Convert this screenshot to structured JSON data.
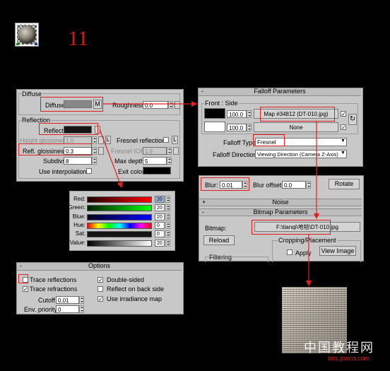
{
  "step_number": "11",
  "material_panel": {
    "diffuse_title": "Diffuse",
    "diffuse_label": "Diffuse",
    "diffuse_map_button": "M",
    "roughness_label": "Roughness",
    "roughness_value": "0.0",
    "reflection_title": "Reflection",
    "reflect_label": "Reflect",
    "hilight_glossiness_label": "Hilight glossiness",
    "hilight_glossiness_value": "1.0",
    "l_button": "L",
    "refl_glossiness_label": "Refl. glossiness",
    "refl_glossiness_value": "0.3",
    "subdivs_label": "Subdivs",
    "subdivs_value": "8",
    "use_interpolation_label": "Use interpolation",
    "fresnel_reflections_label": "Fresnel reflections",
    "fresnel_ior_label": "Fresnel IOR",
    "fresnel_ior_value": "1.6",
    "max_depth_label": "Max depth",
    "max_depth_value": "5",
    "exit_color_label": "Exit color"
  },
  "color_picker": {
    "rows": [
      {
        "label": "Red:",
        "value": "20"
      },
      {
        "label": "Green:",
        "value": "20"
      },
      {
        "label": "Blue:",
        "value": "20"
      },
      {
        "label": "Hue:",
        "value": "0"
      },
      {
        "label": "Sat:",
        "value": "0"
      },
      {
        "label": "Value:",
        "value": "20"
      }
    ]
  },
  "options_panel": {
    "title": "Options",
    "trace_reflections": "Trace reflections",
    "trace_refractions": "Trace refractions",
    "cutoff_label": "Cutoff",
    "cutoff_value": "0.01",
    "env_priority_label": "Env. priority",
    "env_priority_value": "0",
    "double_sided": "Double-sided",
    "reflect_on_back_side": "Reflect on back side",
    "use_irradiance_map": "Use irradiance map"
  },
  "falloff_panel": {
    "title": "Falloff Parameters",
    "front_side_label": "Front : Side",
    "front_amount": "100.0",
    "front_map": "Map #34812 (DT-010.jpg)",
    "side_amount": "100.0",
    "side_map": "None",
    "falloff_type_label": "Falloff Type:",
    "falloff_type_value": "Fresnel",
    "falloff_direction_label": "Falloff Direction:",
    "falloff_direction_value": "Viewing Direction (Camera Z-Axis)"
  },
  "bitmap_panel": {
    "blur_label": "Blur:",
    "blur_value": "0.01",
    "blur_offset_label": "Blur offset:",
    "blur_offset_value": "0.0",
    "rotate_button": "Rotate",
    "noise_title": "Noise",
    "bitmap_params_title": "Bitmap Parameters",
    "bitmap_label": "Bitmap:",
    "bitmap_path": "F:\\tianqi\\地毯\\DT-010.jpg",
    "reload_button": "Reload",
    "cropping_title": "Cropping/Placement",
    "apply_label": "Apply",
    "view_image_button": "View Image",
    "filtering_label": "Filtering"
  },
  "watermark": {
    "cn": "中国教程网",
    "url": "bbs.jcwcn.com"
  },
  "colors": {
    "annotation_red": "#e0201e",
    "panel_gray": "#c8c8c8"
  }
}
